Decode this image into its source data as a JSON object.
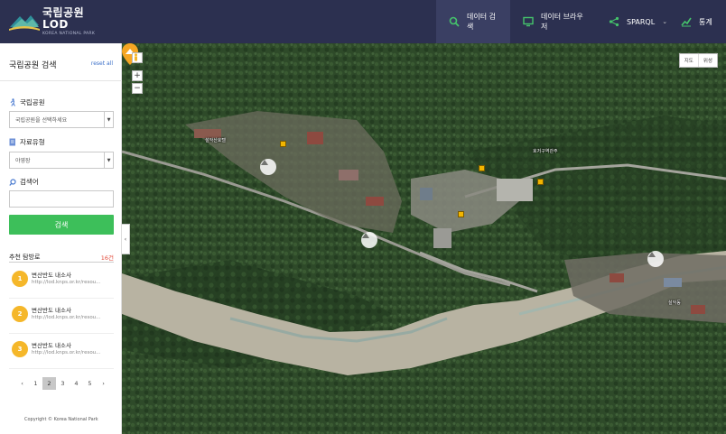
{
  "header": {
    "logo_title": "국립공원 LOD",
    "logo_sub": "KOREA NATIONAL PARK",
    "nav": [
      {
        "label": "데이터 검색",
        "icon": "search-icon"
      },
      {
        "label": "데이터 브라우저",
        "icon": "monitor-icon"
      },
      {
        "label": "SPARQL",
        "icon": "share-icon"
      },
      {
        "label": "통계",
        "icon": "chart-icon"
      }
    ]
  },
  "sidebar": {
    "title": "국립공원 검색",
    "reset_label": "reset all",
    "park_label": "국립공원",
    "park_select_value": "국립공원을 선택하세요",
    "type_label": "자료유형",
    "type_select_value": "야영장",
    "keyword_label": "검색어",
    "keyword_value": "",
    "search_button": "검색",
    "rec_title": "추천 탐방로",
    "rec_count": "16건",
    "rec_items": [
      {
        "num": "1",
        "name": "변산반도 내소사",
        "url": "http://lod.knps.or.kr/resou..."
      },
      {
        "num": "2",
        "name": "변산반도 내소사",
        "url": "http://lod.knps.or.kr/resou..."
      },
      {
        "num": "3",
        "name": "변산반도 내소사",
        "url": "http://lod.knps.or.kr/resou..."
      }
    ],
    "pager": {
      "prev": "‹",
      "pages": [
        "1",
        "2",
        "3",
        "4",
        "5"
      ],
      "active": "2",
      "next": "›"
    },
    "copyright": "Copyright © Korea National Park"
  },
  "map": {
    "zoom_in": "+",
    "zoom_out": "−",
    "type_map": "지도",
    "type_satellite": "위성",
    "collapse": "‹",
    "labels": [
      {
        "text": "설악산호텔"
      },
      {
        "text": "호저구역관주"
      },
      {
        "text": "설악동"
      }
    ]
  },
  "colors": {
    "header_bg": "#2c3050",
    "accent_green": "#3dbf5a",
    "badge_orange": "#f5b72a",
    "link_blue": "#3b6fc8",
    "count_red": "#e24a3a"
  }
}
